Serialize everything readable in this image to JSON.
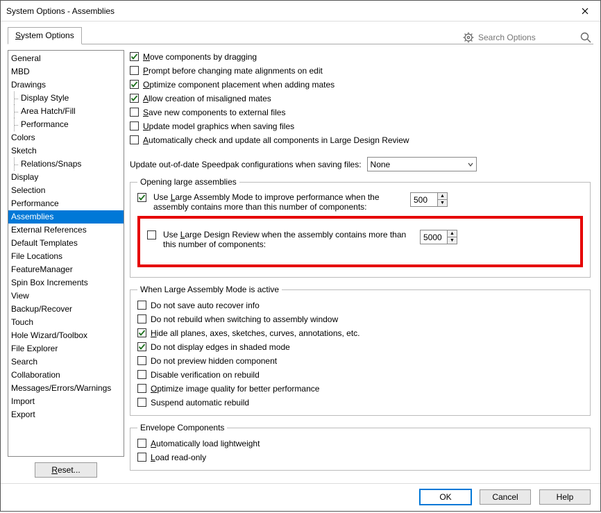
{
  "title": "System Options - Assemblies",
  "tab_label": "System Options",
  "tab_underline_char": "S",
  "search_placeholder": "Search Options",
  "sidebar": [
    {
      "label": "General"
    },
    {
      "label": "MBD"
    },
    {
      "label": "Drawings"
    },
    {
      "label": "Display Style",
      "child": true
    },
    {
      "label": "Area Hatch/Fill",
      "child": true
    },
    {
      "label": "Performance",
      "child": true
    },
    {
      "label": "Colors"
    },
    {
      "label": "Sketch"
    },
    {
      "label": "Relations/Snaps",
      "child": true
    },
    {
      "label": "Display"
    },
    {
      "label": "Selection"
    },
    {
      "label": "Performance"
    },
    {
      "label": "Assemblies",
      "selected": true
    },
    {
      "label": "External References"
    },
    {
      "label": "Default Templates"
    },
    {
      "label": "File Locations"
    },
    {
      "label": "FeatureManager"
    },
    {
      "label": "Spin Box Increments"
    },
    {
      "label": "View"
    },
    {
      "label": "Backup/Recover"
    },
    {
      "label": "Touch"
    },
    {
      "label": "Hole Wizard/Toolbox"
    },
    {
      "label": "File Explorer"
    },
    {
      "label": "Search"
    },
    {
      "label": "Collaboration"
    },
    {
      "label": "Messages/Errors/Warnings"
    },
    {
      "label": "Import"
    },
    {
      "label": "Export"
    }
  ],
  "reset_label": "Reset...",
  "top_checks": [
    {
      "checked": true,
      "text": "Move components by dragging"
    },
    {
      "checked": false,
      "text": "Prompt before changing mate alignments on edit"
    },
    {
      "checked": true,
      "text": "Optimize component placement when adding mates"
    },
    {
      "checked": true,
      "text": "Allow creation of misaligned mates"
    },
    {
      "checked": false,
      "text": "Save new components to external files"
    },
    {
      "checked": false,
      "text": "Update model graphics when saving files"
    },
    {
      "checked": false,
      "text": "Automatically check and update all components in Large Design Review"
    }
  ],
  "speedpak_label": "Update out-of-date Speedpak configurations when saving files:",
  "speedpak_value": "None",
  "groups": {
    "opening": {
      "legend": "Opening large assemblies",
      "row1": {
        "checked": true,
        "text": "Use Large Assembly Mode to improve performance when the assembly contains more than this number of components:",
        "value": "500"
      },
      "row2": {
        "checked": false,
        "text": "Use Large Design Review when the assembly contains more than this number of components:",
        "value": "5000"
      }
    },
    "active": {
      "legend": "When Large Assembly Mode is active",
      "items": [
        {
          "checked": false,
          "text": "Do not save auto recover info"
        },
        {
          "checked": false,
          "text": "Do not rebuild when switching to assembly window"
        },
        {
          "checked": true,
          "text": "Hide all planes, axes, sketches, curves, annotations, etc."
        },
        {
          "checked": true,
          "text": "Do not display edges in shaded mode"
        },
        {
          "checked": false,
          "text": "Do not preview hidden component"
        },
        {
          "checked": false,
          "text": "Disable verification on rebuild"
        },
        {
          "checked": false,
          "text": "Optimize image quality for better performance"
        },
        {
          "checked": false,
          "text": "Suspend automatic rebuild"
        }
      ]
    },
    "envelope": {
      "legend": "Envelope Components",
      "items": [
        {
          "checked": false,
          "text": "Automatically load lightweight"
        },
        {
          "checked": false,
          "text": "Load read-only"
        }
      ]
    }
  },
  "footer": {
    "ok": "OK",
    "cancel": "Cancel",
    "help": "Help"
  }
}
